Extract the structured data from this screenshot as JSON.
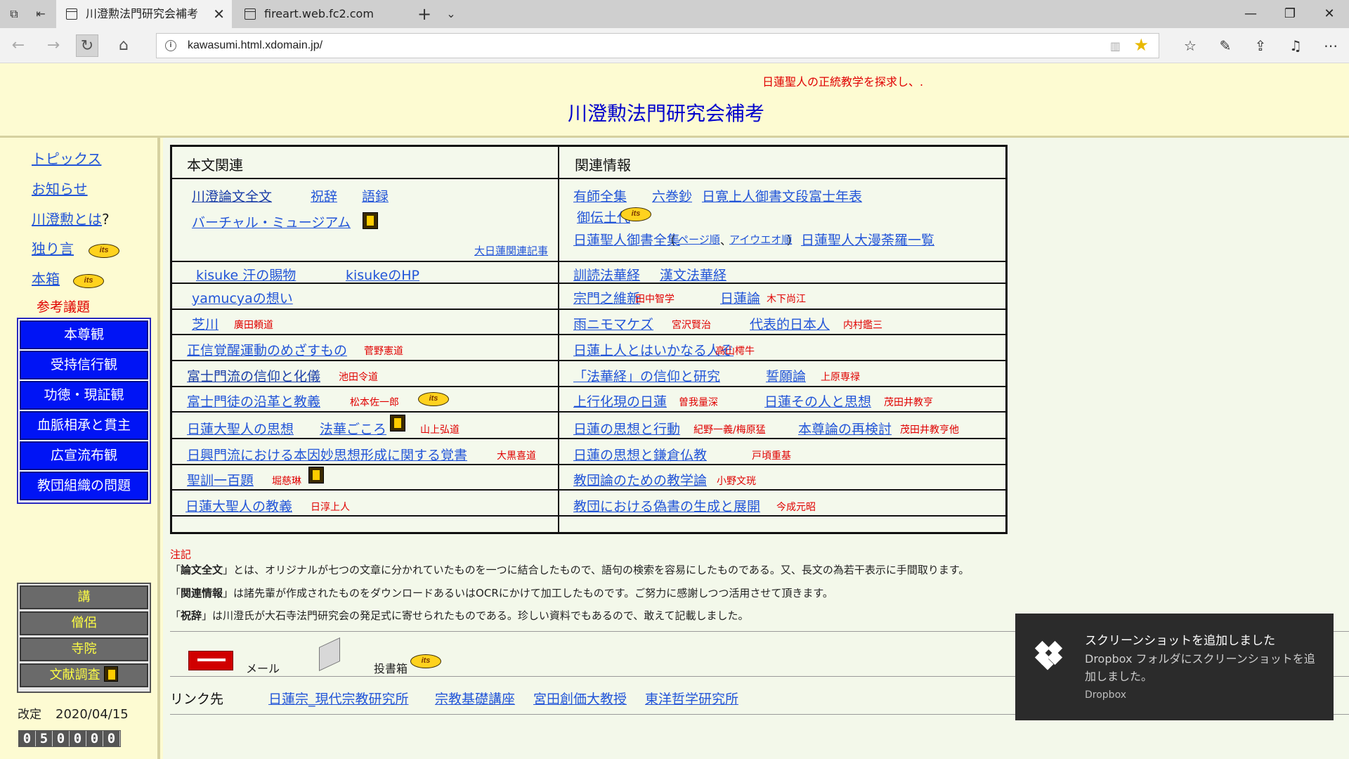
{
  "browser": {
    "tabs": [
      {
        "title": "川澄勲法門研究会補考",
        "active": true
      },
      {
        "title": "fireart.web.fc2.com",
        "active": false
      }
    ],
    "url": "kawasumi.html.xdomain.jp/"
  },
  "header": {
    "subtitle": "日蓮聖人の正統教学を探求し、.",
    "title": "川澄勲法門研究会補考"
  },
  "sidebar": {
    "links": [
      "トピックス",
      "お知らせ",
      "川澄勲とは",
      "独り言",
      "本箱"
    ],
    "question_mark": "?",
    "badge": "its",
    "section_heading": "参考議題",
    "blue_menu": [
      "本尊観",
      "受持信行観",
      "功徳・現証観",
      "血脈相承と貫主",
      "広宣流布観",
      "教団組織の問題"
    ],
    "gray_menu": [
      "講",
      "僧侶",
      "寺院",
      "文献調査"
    ],
    "date_label": "改定",
    "date_value": "2020/04/15",
    "counter": "050000"
  },
  "table": {
    "headers": {
      "left": "本文関連",
      "right": "関連情報"
    },
    "left": {
      "row1": {
        "links": [
          "川澄論文全文",
          "祝辞",
          "語録",
          "バーチャル・ミュージアム"
        ],
        "small_link": "大日蓮関連記事"
      },
      "row2": {
        "links": [
          "kisuke 汗の賜物",
          "kisukeのHP"
        ]
      },
      "row3": {
        "links": [
          "yamucyaの想い"
        ]
      },
      "row4": {
        "link": "芝川",
        "author": "廣田頼道"
      },
      "row5": {
        "link": "正信覚醒運動のめざすもの",
        "author": "菅野憲道"
      },
      "row6": {
        "link": "富士門流の信仰と化儀",
        "author": "池田令道"
      },
      "row7": {
        "link": "富士門徒の沿革と教義",
        "author": "松本佐一郎"
      },
      "row8": {
        "links": [
          "日蓮大聖人の思想",
          "法華ごころ"
        ],
        "author": "山上弘道"
      },
      "row9": {
        "link": "日興門流における本因妙思想形成に関する覚書",
        "author": "大黒喜道"
      },
      "row10": {
        "link": "聖訓一百題",
        "author": "堀慈琳"
      },
      "row11": {
        "link": "日蓮大聖人の教義",
        "author": "日淳上人"
      }
    },
    "right": {
      "row1": {
        "links": [
          "有師全集",
          "六巻鈔",
          "日寛上人御書文段",
          "富士年表",
          "御伝土代",
          "日蓮聖人御書全集",
          "ページ順",
          "アイウエオ順",
          "日蓮聖人大漫荼羅一覧"
        ],
        "paren_open": "（",
        "paren_sep": "、",
        "paren_close": "）"
      },
      "row2": {
        "links": [
          "訓読法華経",
          "漢文法華経"
        ]
      },
      "row3": {
        "links": [
          "宗門之維新",
          "日蓮論"
        ],
        "authors": [
          "田中智学",
          "木下尚江"
        ]
      },
      "row4": {
        "links": [
          "雨ニモマケズ",
          "代表的日本人"
        ],
        "authors": [
          "宮沢賢治",
          "内村鑑三"
        ]
      },
      "row5": {
        "link": "日蓮上人とはいかなる人ぞ",
        "author": "高山樗牛"
      },
      "row6": {
        "links": [
          "「法華経」の信仰と研究",
          "誓願論"
        ],
        "author": "上原専禄"
      },
      "row7": {
        "links": [
          "上行化現の日蓮",
          "日蓮その人と思想"
        ],
        "authors": [
          "曽我量深",
          "茂田井教亨"
        ]
      },
      "row8": {
        "links": [
          "日蓮の思想と行動",
          "本尊論の再検討"
        ],
        "authors": [
          "紀野一義/梅原猛",
          "茂田井教亨他"
        ]
      },
      "row9": {
        "link": "日蓮の思想と鎌倉仏教",
        "author": "戸頃重基"
      },
      "row10": {
        "link": "教団論のための教学論",
        "author": "小野文珖"
      },
      "row11": {
        "link": "教団における偽書の生成と展開",
        "author": "今成元昭"
      }
    }
  },
  "notes": {
    "heading": "注記",
    "items": [
      {
        "open": "「",
        "bold": "論文全文",
        "rest": "」とは、オリジナルが七つの文章に分かれていたものを一つに結合したもので、語句の検索を容易にしたものである。又、長文の為若干表示に手間取ります。"
      },
      {
        "open": "「",
        "bold": "関連情報",
        "rest": "」は諸先輩が作成されたものをダウンロードあるいはOCRにかけて加工したものです。ご努力に感謝しつつ活用させて頂きます。"
      },
      {
        "open": "「",
        "bold": "祝辞",
        "rest": "」は川澄氏が大石寺法門研究会の発足式に寄せられたものである。珍しい資料でもあるので、敢えて記載しました。"
      }
    ]
  },
  "footer": {
    "mail": "メール",
    "post": "投書箱",
    "links_label": "リンク先",
    "links": [
      "日蓮宗_現代宗教研究所",
      "宗教基礎講座",
      "宮田創価大教授",
      "東洋哲学研究所"
    ]
  },
  "toast": {
    "title": "スクリーンショットを追加しました",
    "body": "Dropbox フォルダにスクリーンショットを追加しました。",
    "app": "Dropbox"
  }
}
